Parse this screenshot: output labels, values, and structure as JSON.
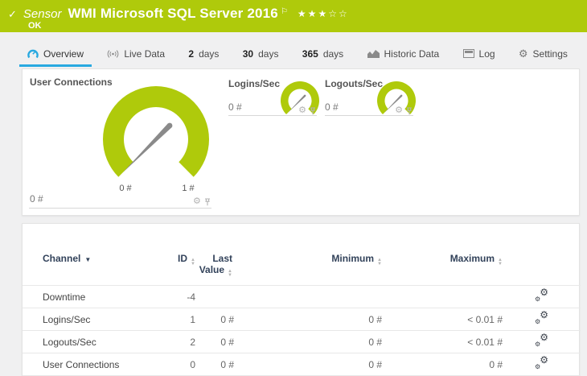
{
  "header": {
    "kind": "Sensor",
    "title": "WMI Microsoft SQL Server 2016",
    "status_text": "OK",
    "stars": "★★★☆☆"
  },
  "tabs": {
    "overview": "Overview",
    "live_data": "Live Data",
    "d2_num": "2",
    "d2_unit": "days",
    "d30_num": "30",
    "d30_unit": "days",
    "d365_num": "365",
    "d365_unit": "days",
    "historic": "Historic Data",
    "log": "Log",
    "settings": "Settings"
  },
  "gauges": {
    "user_connections": {
      "title": "User Connections",
      "value": "0 #",
      "scale_min": "0 #",
      "scale_max": "1 #"
    },
    "logins": {
      "title": "Logins/Sec",
      "value": "0 #"
    },
    "logouts": {
      "title": "Logouts/Sec",
      "value": "0 #"
    }
  },
  "table": {
    "headers": {
      "channel": "Channel",
      "id": "ID",
      "last_value": "Last Value",
      "minimum": "Minimum",
      "maximum": "Maximum"
    },
    "rows": [
      {
        "channel": "Downtime",
        "id": "-4",
        "last": "",
        "min": "",
        "max": ""
      },
      {
        "channel": "Logins/Sec",
        "id": "1",
        "last": "0 #",
        "min": "0 #",
        "max": "< 0.01 #"
      },
      {
        "channel": "Logouts/Sec",
        "id": "2",
        "last": "0 #",
        "min": "0 #",
        "max": "< 0.01 #"
      },
      {
        "channel": "User Connections",
        "id": "0",
        "last": "0 #",
        "min": "0 #",
        "max": "0 #"
      }
    ]
  },
  "icons": {
    "check": "✓",
    "flag": "⚐",
    "gear": "⚙",
    "sort_asc": "▲",
    "sort_desc": "▼"
  },
  "colors": {
    "accent_green": "#AFCA0B",
    "accent_blue": "#29A9E0",
    "header_navy": "#32425A"
  }
}
